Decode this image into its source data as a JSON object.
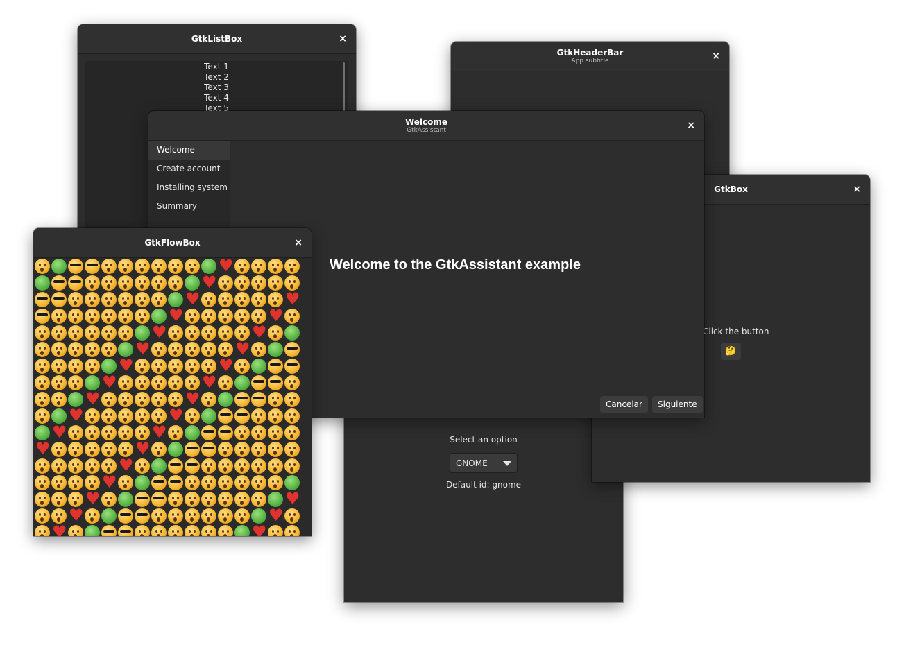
{
  "dropdown_window": {
    "label": "Select an option",
    "selected": "GNOME",
    "default_text": "Default id: gnome"
  },
  "listbox_window": {
    "title": "GtkListBox",
    "close_symbol": "×",
    "items": [
      "Text 1",
      "Text 2",
      "Text 3",
      "Text 4",
      "Text 5"
    ]
  },
  "headerbar_window": {
    "title": "GtkHeaderBar",
    "subtitle": "App subtitle",
    "close_symbol": "×"
  },
  "box_window": {
    "title": "GtkBox",
    "close_symbol": "×",
    "label": "Click the button",
    "button_icon": "thinking-face-emoji",
    "button_glyph": "🤔"
  },
  "assistant_window": {
    "title": "Welcome",
    "subtitle": "GtkAssistant",
    "close_symbol": "×",
    "steps": [
      "Welcome",
      "Create account",
      "Installing system",
      "Summary"
    ],
    "active_step": "Welcome",
    "heading": "Welcome to the GtkAssistant example",
    "cancel_label": "Cancelar",
    "next_label": "Siguiente"
  },
  "flowbox_window": {
    "title": "GtkFlowBox",
    "close_symbol": "×",
    "content": "grid of emoji icons"
  },
  "colors": {
    "window_bg": "#2d2d2d",
    "titlebar_bg": "#303030",
    "desktop_bg": "#ffffff",
    "heart": "#e0332e",
    "emoji_yellow": "#f7b733",
    "emoji_green": "#56b243"
  }
}
